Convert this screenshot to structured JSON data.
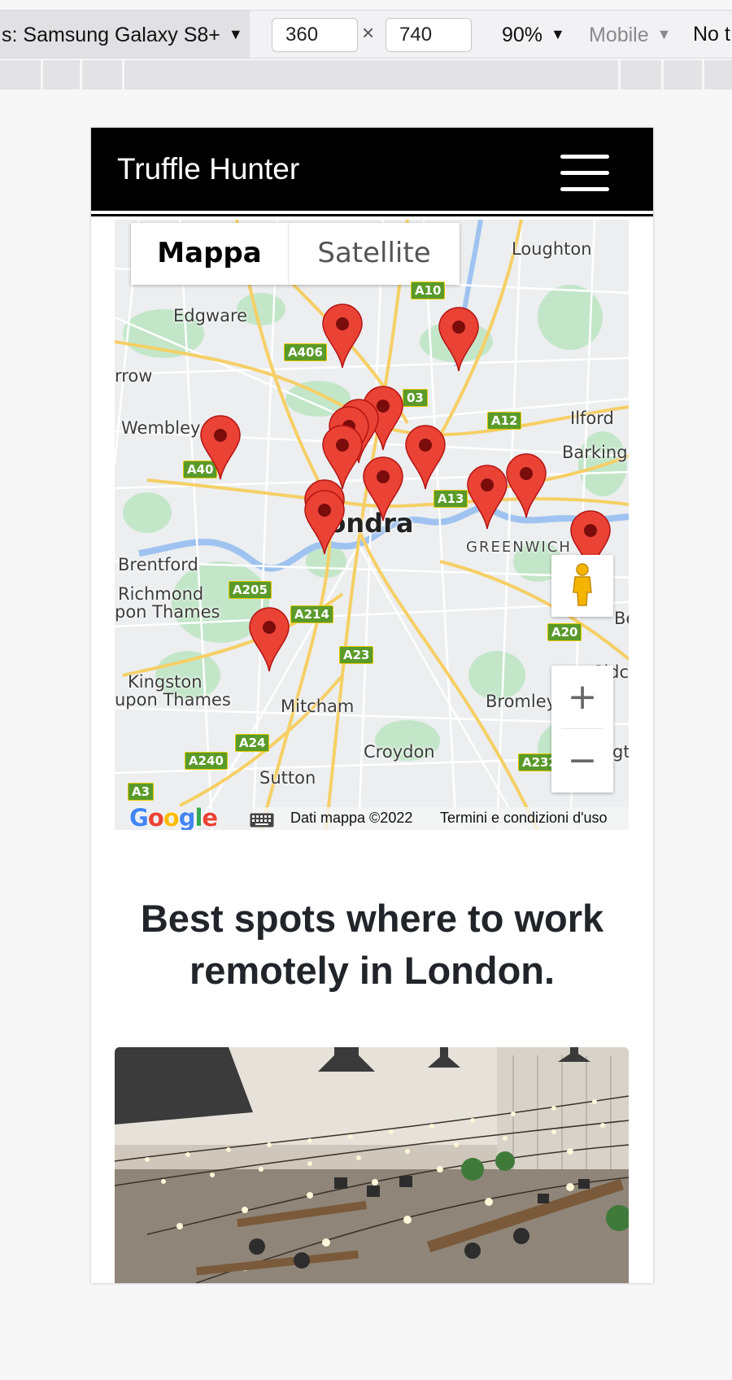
{
  "devtools": {
    "device": "s: Samsung Galaxy S8+",
    "width": "360",
    "height": "740",
    "times": "×",
    "zoom": "90%",
    "mode": "Mobile",
    "throttle": "No t",
    "caret": "▼"
  },
  "navbar": {
    "brand": "Truffle Hunter"
  },
  "map": {
    "type_buttons": {
      "map": "Mappa",
      "satellite": "Satellite"
    },
    "places": {
      "loughton": "Loughton",
      "edgware": "Edgware",
      "harrow": "rrow",
      "wembley": "Wembley",
      "ilford": "Ilford",
      "barking": "Barking",
      "londra": "Londra",
      "greenwich": "GREENWICH",
      "brentford": "Brentford",
      "richmond1": "Richmond",
      "richmond2": "pon Thames",
      "bexley": "Be",
      "sidcup": "Sidc",
      "kingston1": "Kingston",
      "kingston2": "upon Thames",
      "mitcham": "Mitcham",
      "bromley": "Bromley",
      "croydon": "Croydon",
      "sutton": "Sutton",
      "orpington": "gt"
    },
    "roads": {
      "a10": "A10",
      "a406": "A406",
      "a503": "03",
      "a12": "A12",
      "a40": "A40",
      "a13": "A13",
      "a205": "A205",
      "a214": "A214",
      "a20": "A20",
      "a23": "A23",
      "a24": "A24",
      "a240": "A240",
      "a232": "A232",
      "a3": "A3"
    },
    "zoom_in": "+",
    "zoom_out": "−",
    "google": "Google",
    "map_data": "Dati mappa ©2022",
    "terms": "Termini e condizioni d'uso",
    "marker_color": "#ea4335"
  },
  "headline": "Best spots where to work remotely in London."
}
